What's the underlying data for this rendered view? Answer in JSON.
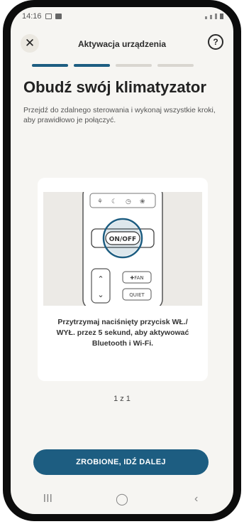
{
  "status_bar": {
    "time": "14:16"
  },
  "header": {
    "title": "Aktywacja urządzenia",
    "close_icon": "close-icon",
    "help_icon": "help-icon"
  },
  "progress": {
    "steps_total": 4,
    "steps_done": 2
  },
  "main": {
    "heading": "Obudź swój klimatyzator",
    "description": "Przejdź do zdalnego sterowania i wykonaj wszystkie kroki, aby prawidłowo je połączyć."
  },
  "card": {
    "remote": {
      "on_off": "ON/OFF",
      "fan": "✚FAN",
      "quiet": "QUIET"
    },
    "instruction": "Przytrzymaj naciśnięty przycisk WŁ./ WYŁ. przez 5 sekund, aby aktywować Bluetooth i Wi-Fi."
  },
  "pager": "1 z 1",
  "primary_button": "ZROBIONE, IDŹ DALEJ",
  "nav": {
    "recents": "III",
    "home": "◯",
    "back": "‹"
  },
  "colors": {
    "accent": "#1d5d81",
    "background": "#f6f5f2"
  }
}
